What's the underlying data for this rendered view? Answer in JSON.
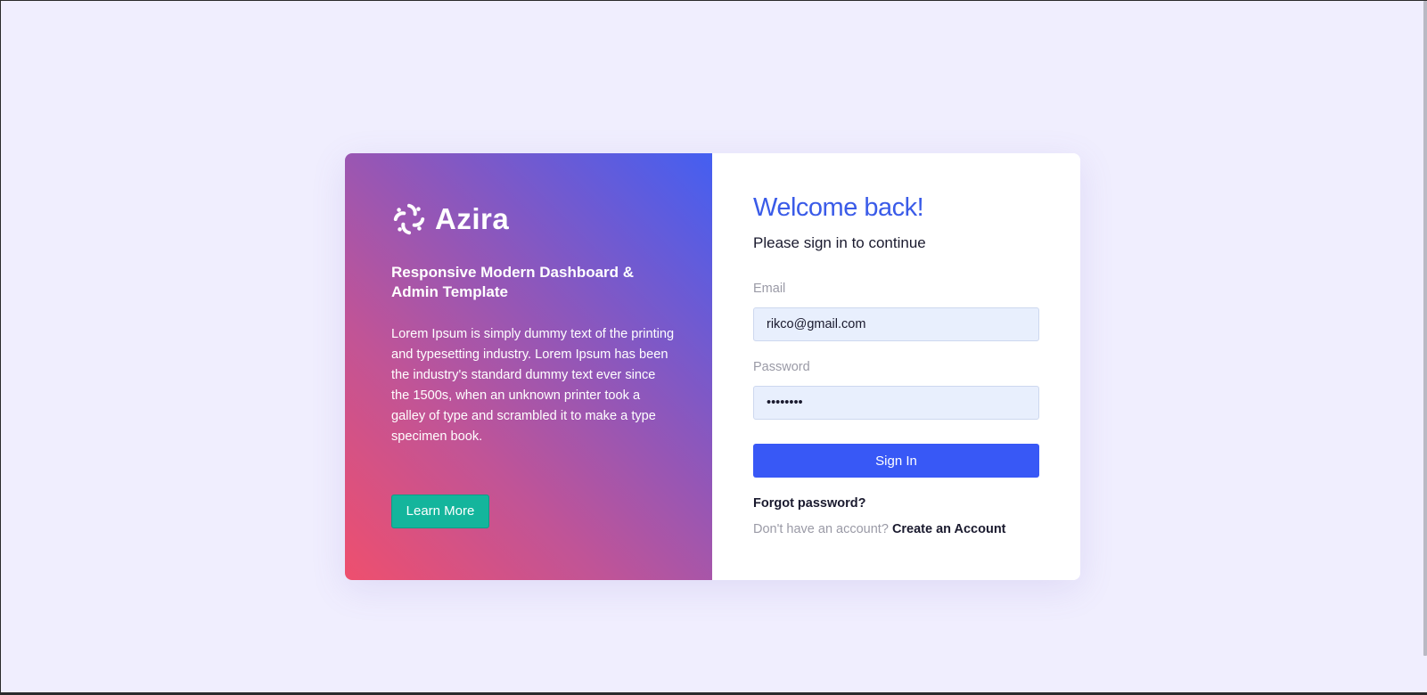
{
  "brand": {
    "name": "Azira",
    "logo_icon": "azira-swirl-logo-icon"
  },
  "promo": {
    "title": "Responsive Modern Dashboard & Admin Template",
    "description": "Lorem Ipsum is simply dummy text of the printing and typesetting industry. Lorem Ipsum has been the industry's standard dummy text ever since the 1500s, when an unknown printer took a galley of type and scrambled it to make a type specimen book.",
    "button_label": "Learn More"
  },
  "signin": {
    "heading": "Welcome back!",
    "subheading": "Please sign in to continue",
    "email_label": "Email",
    "email_value": "rikco@gmail.com",
    "password_label": "Password",
    "password_value": "12345678",
    "submit_label": "Sign In",
    "forgot_label": "Forgot password?",
    "no_account_text": "Don't have an account?",
    "create_account_label": "Create an Account"
  },
  "colors": {
    "page_background": "#f0eefe",
    "heading_accent": "#3a5be8",
    "primary_button": "#3858f6",
    "learn_more_button": "#14b59c",
    "gradient_start": "#ee4f6e",
    "gradient_end": "#445ff1",
    "input_background": "#e8effd"
  }
}
